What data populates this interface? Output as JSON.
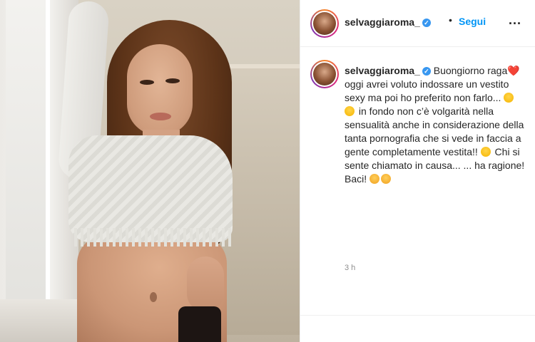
{
  "header": {
    "username": "selvaggiaroma_",
    "separator": "•",
    "follow_label": "Segui",
    "more_label": "..."
  },
  "caption": {
    "username": "selvaggiaroma_",
    "line1": "Buongiorno raga",
    "line2": " oggi avrei voluto indossare un vestito sexy ma poi ho preferito non farlo...",
    "line3": " in fondo non c’è volgarità nella sensualità anche in considerazione della tanta pornografia che si vede in faccia a gente completamente vestita!!",
    "line4": " Chi si sente chiamato in causa... ... ha ragione! Baci!",
    "heart": "❤️"
  },
  "timestamp": "3 h",
  "icons": {
    "verified": "verified-badge-icon",
    "more": "more-options-icon"
  },
  "colors": {
    "accent": "#0095f6",
    "verified": "#3897f0",
    "muted": "#8e8e8e"
  }
}
